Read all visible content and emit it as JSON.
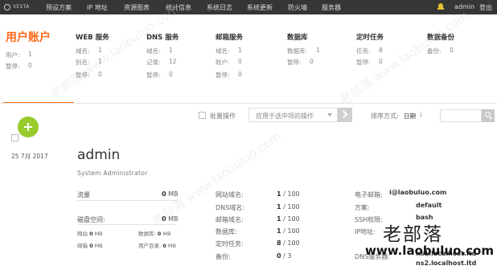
{
  "app": {
    "logo_text": "VESTA"
  },
  "nav": {
    "items": [
      "预设方案",
      "IP 地址",
      "资源图表",
      "统计信息",
      "系统日志",
      "系统更新",
      "防火墙",
      "服务器"
    ],
    "user": "admin",
    "logout": "登出"
  },
  "stats": {
    "accounts": {
      "title": "用户账户",
      "rows": [
        {
          "label": "用户:",
          "value": "1"
        },
        {
          "label": "暂停:",
          "value": "0"
        }
      ]
    },
    "services": [
      {
        "title": "WEB 服务",
        "rows": [
          {
            "label": "域名:",
            "value": "1"
          },
          {
            "label": "别名:",
            "value": "1"
          },
          {
            "label": "暂停:",
            "value": "0"
          }
        ]
      },
      {
        "title": "DNS 服务",
        "rows": [
          {
            "label": "域名:",
            "value": "1"
          },
          {
            "label": "记录:",
            "value": "12"
          },
          {
            "label": "暂停:",
            "value": "0"
          }
        ]
      },
      {
        "title": "邮箱服务",
        "rows": [
          {
            "label": "域名:",
            "value": "1"
          },
          {
            "label": "账户:",
            "value": "0"
          },
          {
            "label": "暂停:",
            "value": "0"
          }
        ]
      },
      {
        "title": "数据库",
        "rows": [
          {
            "label": "数据库:",
            "value": "1"
          },
          {
            "label": "暂停:",
            "value": "0"
          }
        ]
      },
      {
        "title": "定时任务",
        "rows": [
          {
            "label": "任务:",
            "value": "8"
          },
          {
            "label": "暂停:",
            "value": "0"
          }
        ]
      },
      {
        "title": "数据备份",
        "rows": [
          {
            "label": "备份:",
            "value": "0"
          }
        ]
      }
    ]
  },
  "toolbar": {
    "bulk_label": "批量操作",
    "bulk_select": "应用于选中项的操作",
    "sort_label": "排序方式:",
    "sort_value": "日期",
    "sort_arrow": "↓"
  },
  "user_card": {
    "date": "25  7月  2017",
    "username": "admin",
    "role": "System Administrator",
    "bandwidth": {
      "label": "流量",
      "value": "0",
      "unit": "MB"
    },
    "disk": {
      "label": "磁盘空间:",
      "value": "0",
      "unit": "MB"
    },
    "disk_breakdown": [
      {
        "label": "网站",
        "value": "0",
        "unit": "MB"
      },
      {
        "label": "数据库:",
        "value": "0",
        "unit": "MB"
      },
      {
        "label": "邮箱",
        "value": "0",
        "unit": "MB"
      },
      {
        "label": "用户目录:",
        "value": "0",
        "unit": "MB"
      }
    ],
    "limits": [
      {
        "label": "网站域名:",
        "value": "1",
        "max": "/ 100"
      },
      {
        "label": "DNS域名:",
        "value": "1",
        "max": "/ 100"
      },
      {
        "label": "邮箱域名:",
        "value": "1",
        "max": "/ 100"
      },
      {
        "label": "数据库:",
        "value": "1",
        "max": "/ 100"
      },
      {
        "label": "定时任务:",
        "value": "8",
        "max": "/ 100"
      },
      {
        "label": "备份:",
        "value": "0",
        "max": "/ 3"
      }
    ],
    "info": [
      {
        "label": "电子邮箱:",
        "value": "i@laobuluo.com"
      },
      {
        "label": "方案:",
        "value": "default"
      },
      {
        "label": "SSH权限:",
        "value": "bash"
      },
      {
        "label": "IP地址:",
        "value": ""
      },
      {
        "label": "DNS服务器:",
        "value": "ns2.localhost.ltd"
      }
    ],
    "info_extra": "ns1.localhost.ltd"
  },
  "watermark": {
    "cn": "老部落",
    "url": "www.laobuluo.com"
  }
}
